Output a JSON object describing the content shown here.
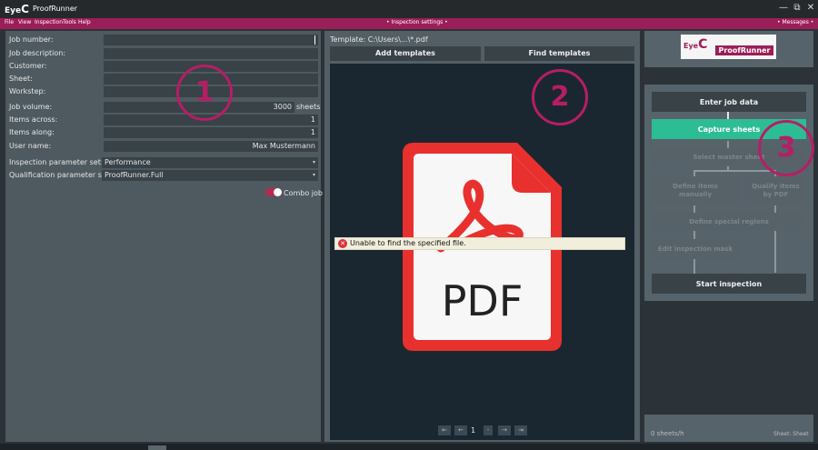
{
  "app": {
    "logo_text": "Eye",
    "logo_c": "C",
    "title": "ProofRunner",
    "minimize_icon": "—",
    "maximize_icon": "⧉",
    "close_icon": "✕"
  },
  "menu": {
    "items": [
      "File",
      "View",
      "Inspection",
      "Tools",
      "Help"
    ],
    "center_link": "• Inspection settings •",
    "right_link": "• Messages •"
  },
  "job": {
    "job_number_label": "Job number:",
    "job_number_value": "",
    "job_description_label": "Job description:",
    "customer_label": "Customer:",
    "sheet_label": "Sheet:",
    "workstep_label": "Workstep:",
    "job_volume_label": "Job volume:",
    "job_volume_value": "3000",
    "job_volume_unit": "sheets",
    "items_across_label": "Items across:",
    "items_across_value": "1",
    "items_along_label": "Items along:",
    "items_along_value": "1",
    "user_name_label": "User name:",
    "user_name_value": "Max Mustermann",
    "inspection_param_label": "Inspection parameter set:",
    "inspection_param_value": "Performance",
    "qualification_param_label": "Qualification parameter set:",
    "qualification_param_value": "ProofRunner.Full",
    "combo_job_label": "Combo job",
    "combo_job_on": true
  },
  "annotations": [
    "1",
    "2",
    "3"
  ],
  "template": {
    "path": "Template: C:\\Users\\...\\*.pdf",
    "add_button": "Add templates",
    "find_button": "Find templates",
    "pdf_label": "PDF",
    "error_text": "Unable to find the specified file.",
    "page_number": "1"
  },
  "workflow": {
    "logo_eye": "Eye",
    "logo_c": "C",
    "logo_name": "ProofRunner",
    "enter_job_data": "Enter job data",
    "capture_sheets": "Capture sheets",
    "select_master_sheet": "Select master sheet",
    "define_items_manually": "Define items manually",
    "qualify_items_by_pdf": "Qualify items by PDF",
    "define_special_regions": "Define special regions",
    "edit_inspection_mask": "Edit inspection mask",
    "start_inspection": "Start inspection",
    "rate": "0 sheets/h",
    "sheet_status": "Sheet: Sheet"
  },
  "colors": {
    "accent": "#9c1e58",
    "active_step": "#2dbd95",
    "pdf_red": "#e8312e"
  }
}
